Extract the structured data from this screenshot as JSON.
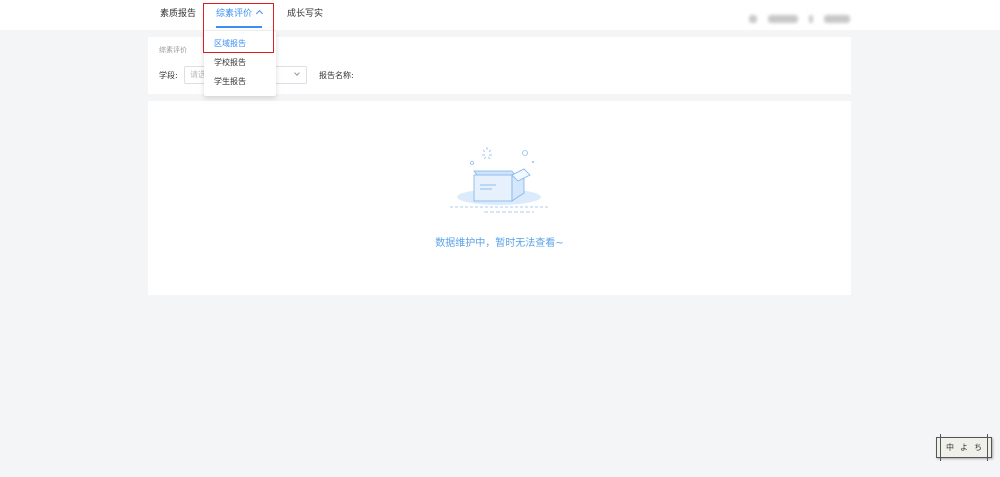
{
  "nav": {
    "items": [
      {
        "label": "素质报告"
      },
      {
        "label": "综素评价"
      },
      {
        "label": "成长写实"
      }
    ]
  },
  "dropdown": {
    "items": [
      {
        "label": "区域报告"
      },
      {
        "label": "学校报告"
      },
      {
        "label": "学生报告"
      }
    ]
  },
  "filter": {
    "breadcrumb": "综素评价",
    "stage_label": "学段:",
    "stage_placeholder": "请选",
    "report_name_label": "报告名称:"
  },
  "empty": {
    "message": "数据维护中，暂时无法查看~"
  },
  "corner_widget": {
    "glyphs": [
      "中",
      "よ",
      "ち"
    ]
  },
  "colors": {
    "accent": "#3d8ff5",
    "highlight": "#e02020",
    "empty_text": "#5aa3e8"
  }
}
